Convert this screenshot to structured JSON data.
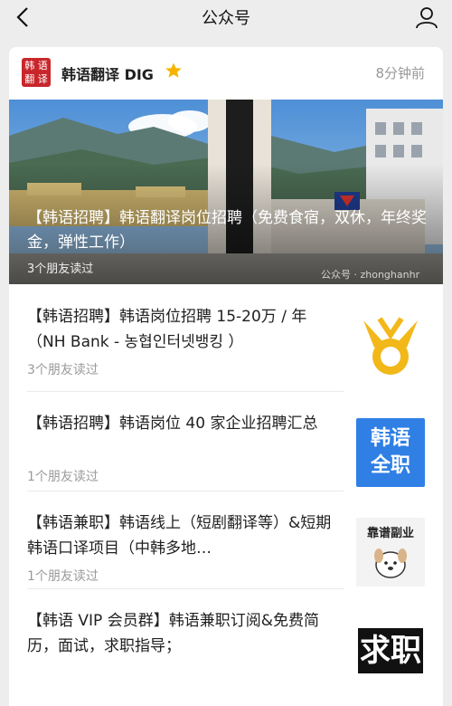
{
  "topbar": {
    "title": "公众号",
    "back_icon": "chevron-left-icon",
    "user_icon": "user-profile-icon"
  },
  "account": {
    "logo_chars": [
      "韩",
      "语",
      "翻",
      "译"
    ],
    "name": "韩语翻译 DIG",
    "badge_icon": "star-icon",
    "badge_color": "#f5b400",
    "time": "8分钟前"
  },
  "hero": {
    "title": "【韩语招聘】韩语翻译岗位招聘（免费食宿，双休，年终奖金，弹性工作）",
    "read": "3个朋友读过",
    "watermark": "公众号 · zhonghanhr"
  },
  "articles": [
    {
      "title": "【韩语招聘】韩语岗位招聘 15-20万 / 年（NH Bank - 농협인터넷뱅킹 ）",
      "read": "3个朋友读过",
      "thumb": "nh-bank-logo"
    },
    {
      "title": "【韩语招聘】韩语岗位 40 家企业招聘汇总",
      "read": "1个朋友读过",
      "thumb_lines": [
        "韩语",
        "全职"
      ]
    },
    {
      "title": "【韩语兼职】韩语线上（短剧翻译等）&短期韩语口译项目（中韩多地…",
      "read": "1个朋友读过",
      "thumb_text": "靠谱副业"
    },
    {
      "title": "【韩语 VIP 会员群】韩语兼职订阅&免费简历，面试，求职指导；",
      "read": "",
      "thumb_text": "求职"
    }
  ],
  "colors": {
    "brand_red": "#c8262b",
    "accent_blue": "#2f7fe5",
    "nh_yellow": "#f2b81a"
  }
}
